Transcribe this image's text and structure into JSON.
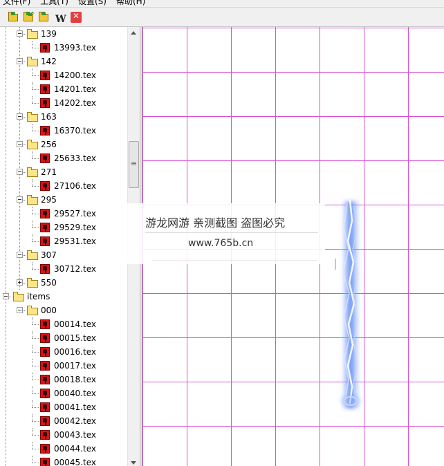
{
  "menu": [
    "文件(F)",
    "工具(T)",
    "设置(S)",
    "帮助(H)"
  ],
  "toolbar": {
    "buttons": [
      {
        "icon": "open-folder-icon"
      },
      {
        "icon": "folder-up-icon"
      },
      {
        "icon": "folder-export-icon"
      },
      {
        "icon": "w-icon",
        "text": "W"
      },
      {
        "icon": "close-x-icon"
      }
    ]
  },
  "tree": {
    "items": [
      {
        "label": "139",
        "type": "folder",
        "level": 1
      },
      {
        "label": "13993.tex",
        "type": "file",
        "level": 2
      },
      {
        "label": "142",
        "type": "folder",
        "level": 1
      },
      {
        "label": "14200.tex",
        "type": "file",
        "level": 2
      },
      {
        "label": "14201.tex",
        "type": "file",
        "level": 2
      },
      {
        "label": "14202.tex",
        "type": "file",
        "level": 2
      },
      {
        "label": "163",
        "type": "folder",
        "level": 1
      },
      {
        "label": "16370.tex",
        "type": "file",
        "level": 2
      },
      {
        "label": "256",
        "type": "folder",
        "level": 1
      },
      {
        "label": "25633.tex",
        "type": "file",
        "level": 2
      },
      {
        "label": "271",
        "type": "folder",
        "level": 1
      },
      {
        "label": "27106.tex",
        "type": "file",
        "level": 2
      },
      {
        "label": "295",
        "type": "folder",
        "level": 1
      },
      {
        "label": "29527.tex",
        "type": "file",
        "level": 2
      },
      {
        "label": "29529.tex",
        "type": "file",
        "level": 2
      },
      {
        "label": "29531.tex",
        "type": "file",
        "level": 2
      },
      {
        "label": "307",
        "type": "folder",
        "level": 1
      },
      {
        "label": "30712.tex",
        "type": "file",
        "level": 2
      },
      {
        "label": "550",
        "type": "folder",
        "level": 1,
        "collapsed": true
      },
      {
        "label": "items",
        "type": "folder",
        "level": 0
      },
      {
        "label": "000",
        "type": "folder",
        "level": 1
      },
      {
        "label": "00014.tex",
        "type": "file",
        "level": 2
      },
      {
        "label": "00015.tex",
        "type": "file",
        "level": 2
      },
      {
        "label": "00016.tex",
        "type": "file",
        "level": 2
      },
      {
        "label": "00017.tex",
        "type": "file",
        "level": 2
      },
      {
        "label": "00018.tex",
        "type": "file",
        "level": 2
      },
      {
        "label": "00040.tex",
        "type": "file",
        "level": 2
      },
      {
        "label": "00041.tex",
        "type": "file",
        "level": 2
      },
      {
        "label": "00042.tex",
        "type": "file",
        "level": 2
      },
      {
        "label": "00043.tex",
        "type": "file",
        "level": 2
      },
      {
        "label": "00044.tex",
        "type": "file",
        "level": 2
      },
      {
        "label": "00045.tex",
        "type": "file",
        "level": 2
      }
    ]
  },
  "watermark": {
    "line1": "游龙网游 亲测截图 盗图必究",
    "line2": "www.765b.cn"
  },
  "colors": {
    "grid": "#d94fd9",
    "tex_icon": "#d41414",
    "folder": "#fde68a",
    "effect": "#6f96f0"
  }
}
